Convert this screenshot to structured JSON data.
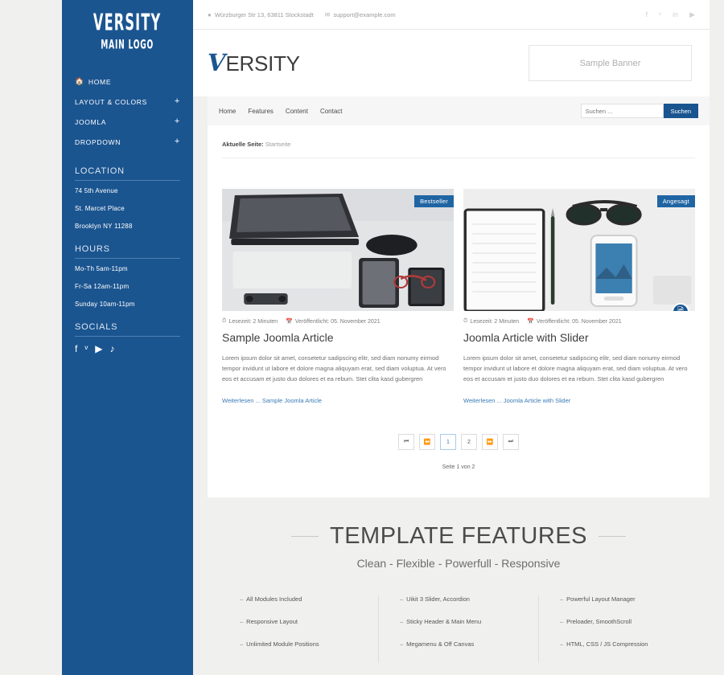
{
  "colors": {
    "brand_blue": "#1b5590",
    "accent_link": "#3b7bb5",
    "page_bg": "#f0f0ef",
    "badge_blue": "#2065a3"
  },
  "sidebar": {
    "logo_main": "VERSITY",
    "logo_sub": "MAIN LOGO",
    "nav": [
      {
        "label": "HOME",
        "icon": "home-icon",
        "expand": ""
      },
      {
        "label": "LAYOUT & COLORS",
        "icon": "",
        "expand": "+"
      },
      {
        "label": "JOOMLA",
        "icon": "",
        "expand": "+"
      },
      {
        "label": "DROPDOWN",
        "icon": "",
        "expand": "+"
      }
    ],
    "location": {
      "title": "LOCATION",
      "lines": [
        "74 5th Avenue",
        "St. Marcet Place",
        "Brooklyn NY 11288"
      ]
    },
    "hours": {
      "title": "HOURS",
      "lines": [
        "Mo-Th 5am-11pm",
        "Fr-Sa 12am-11pm",
        "Sunday 10am-11pm"
      ]
    },
    "socials": {
      "title": "SOCIALS",
      "icons": [
        "facebook-icon",
        "twitter-icon",
        "youtube-icon",
        "tiktok-icon"
      ],
      "glyphs": [
        "f",
        "ᵛ",
        "▶",
        "♪"
      ]
    }
  },
  "topbar": {
    "address": "Würzburger Str 13, 63811 Stockstadt",
    "email": "support@example.com",
    "address_icon": "location-pin-icon",
    "email_icon": "envelope-icon",
    "social_icons": [
      "facebook-icon",
      "twitter-icon",
      "linkedin-icon",
      "youtube-icon"
    ],
    "social_glyphs": [
      "f",
      "ᵛ",
      "in",
      "▶"
    ]
  },
  "header": {
    "brand_first": "V",
    "brand_rest": "ERSITY",
    "banner_text": "Sample Banner"
  },
  "menubar": {
    "links": [
      "Home",
      "Features",
      "Content",
      "Contact"
    ],
    "search_placeholder": "Suchen ...",
    "search_value": "",
    "search_button": "Suchen"
  },
  "breadcrumb": {
    "label": "Aktuelle Seite:",
    "current": "Startseite"
  },
  "articles": [
    {
      "badge": "Bestseller",
      "image_name": "laptop-desk-photo",
      "read_icon": "clock-icon",
      "read_time": "Lesezeit: 2 Minuten",
      "date_icon": "calendar-icon",
      "published": "Veröffentlicht: 05. November 2021",
      "title": "Sample Joomla Article",
      "text": "Lorem ipsum dolor sit amet, consetetur sadipscing elitr, sed diam nonumy eirmod tempor invidunt ut labore et dolore magna aliquyam erat, sed diam voluptua. At vero eos et accusam et justo duo dolores et ea rebum. Stet clita kasd gubergren",
      "readmore": "Weiterlesen ... Sample Joomla Article",
      "has_gallery_badge": false
    },
    {
      "badge": "Angesagt",
      "image_name": "notebook-sunglasses-phone-photo",
      "read_icon": "clock-icon",
      "read_time": "Lesezeit: 2 Minuten",
      "date_icon": "calendar-icon",
      "published": "Veröffentlicht: 05. November 2021",
      "title": "Joomla Article with Slider",
      "text": "Lorem ipsum dolor sit amet, consetetur sadipscing elitr, sed diam nonumy eirmod tempor invidunt ut labore et dolore magna aliquyam erat, sed diam voluptua. At vero eos et accusam et justo duo dolores et ea rebum. Stet clita kasd gubergren",
      "readmore": "Weiterlesen ... Joomla Article with Slider",
      "has_gallery_badge": true,
      "gallery_icon": "image-gallery-icon"
    }
  ],
  "pagination": {
    "buttons": [
      {
        "label": "⏮",
        "name": "first-page-button",
        "active": false
      },
      {
        "label": "⏪",
        "name": "prev-page-button",
        "active": false
      },
      {
        "label": "1",
        "name": "page-1-button",
        "active": true
      },
      {
        "label": "2",
        "name": "page-2-button",
        "active": false
      },
      {
        "label": "⏩",
        "name": "next-page-button",
        "active": false
      },
      {
        "label": "⏭",
        "name": "last-page-button",
        "active": false
      }
    ],
    "page_count": "Seite 1 von 2"
  },
  "features": {
    "title": "TEMPLATE FEATURES",
    "subtitle": "Clean - Flexible - Powerfull - Responsive",
    "columns": [
      [
        "All Modules Included",
        "Responsive Layout",
        "Unlimited Module Positions"
      ],
      [
        "Uikit 3 Slider, Accordion",
        "Sticky Header & Main Menu",
        "Megamenu & Off Canvas"
      ],
      [
        "Powerful Layout Manager",
        "Preloader, SmoothScroll",
        "HTML, CSS / JS Compression"
      ]
    ]
  }
}
